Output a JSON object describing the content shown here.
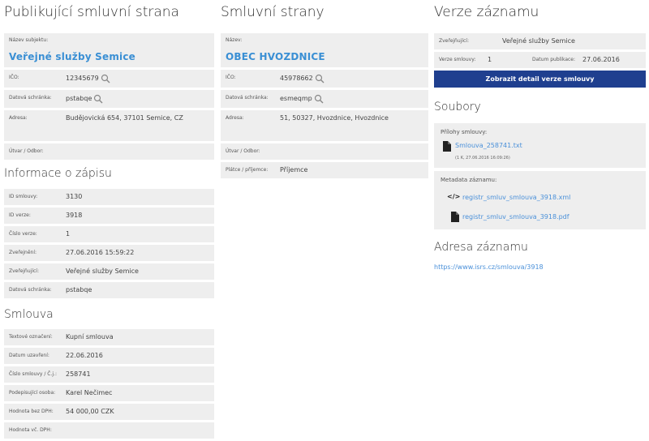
{
  "col1": {
    "title": "Publikující smluvní strana",
    "name_label": "Název subjektu:",
    "name_value": "Veřejné služby Semice",
    "ico_label": "IČO:",
    "ico_value": "12345679",
    "datova_label": "Datová schránka:",
    "datova_value": "pstabqe",
    "adresa_label": "Adresa:",
    "adresa_value": "Budějovická 654, 37101 Semice, CZ",
    "utvar_label": "Útvar / Odbor:",
    "zapis_title": "Informace o zápisu",
    "zapis": [
      {
        "label": "ID smlouvy:",
        "value": "3130"
      },
      {
        "label": "ID verze:",
        "value": "3918"
      },
      {
        "label": "Číslo verze:",
        "value": "1"
      },
      {
        "label": "Zveřejnění:",
        "value": "27.06.2016 15:59:22"
      },
      {
        "label": "Zveřejňující:",
        "value": "Veřejné služby Semice"
      },
      {
        "label": "Datová schránka:",
        "value": "pstabqe"
      }
    ],
    "smlouva_title": "Smlouva",
    "smlouva": [
      {
        "label": "Textové označení:",
        "value": "Kupní smlouva"
      },
      {
        "label": "Datum uzavření:",
        "value": "22.06.2016"
      },
      {
        "label": "Číslo smlouvy / Č.j.:",
        "value": "258741"
      },
      {
        "label": "Podepisující osoba:",
        "value": "Karel Nečimec"
      },
      {
        "label": "Hodnota bez DPH:",
        "value": "54 000,00 CZK"
      },
      {
        "label": "Hodnota vč. DPH:",
        "value": ""
      }
    ]
  },
  "col2": {
    "title": "Smluvní strany",
    "name_label": "Název:",
    "name_value": "OBEC HVOZDNICE",
    "ico_label": "IČO:",
    "ico_value": "45978662",
    "datova_label": "Datová schránka:",
    "datova_value": "esmeqmp",
    "adresa_label": "Adresa:",
    "adresa_value": "51, 50327, Hvozdnice, Hvozdnice",
    "utvar_label": "Útvar / Odbor:",
    "platce_label": "Plátce / příjemce:",
    "platce_value": "Příjemce"
  },
  "col3": {
    "title": "Verze záznamu",
    "zverejnujici_label": "Zveřejňující:",
    "zverejnujici_value": "Veřejné služby Semice",
    "verze_label": "Verze smlouvy:",
    "verze_value": "1",
    "datum_label": "Datum publikace:",
    "datum_value": "27.06.2016",
    "button_label": "Zobrazit detail verze smlouvy",
    "soubory_title": "Soubory",
    "prilohy_label": "Přílohy smlouvy:",
    "prilohy_file": "Smlouva_258741.txt",
    "prilohy_meta": "(1 K, 27.06.2016 16:09:26)",
    "metadata_label": "Metadata záznamu:",
    "meta_xml": "registr_smluv_smlouva_3918.xml",
    "meta_pdf": "registr_smluv_smlouva_3918.pdf",
    "adresa_title": "Adresa záznamu",
    "adresa_url": "https://www.isrs.cz/smlouva/3918"
  },
  "icons": {
    "search": "magnifier-icon",
    "file": "document-icon",
    "code": "code-icon",
    "pdf": "pdf-icon"
  },
  "colors": {
    "link": "#3a8fd4",
    "button": "#1f3f8f",
    "row_bg": "#eeeeee"
  }
}
